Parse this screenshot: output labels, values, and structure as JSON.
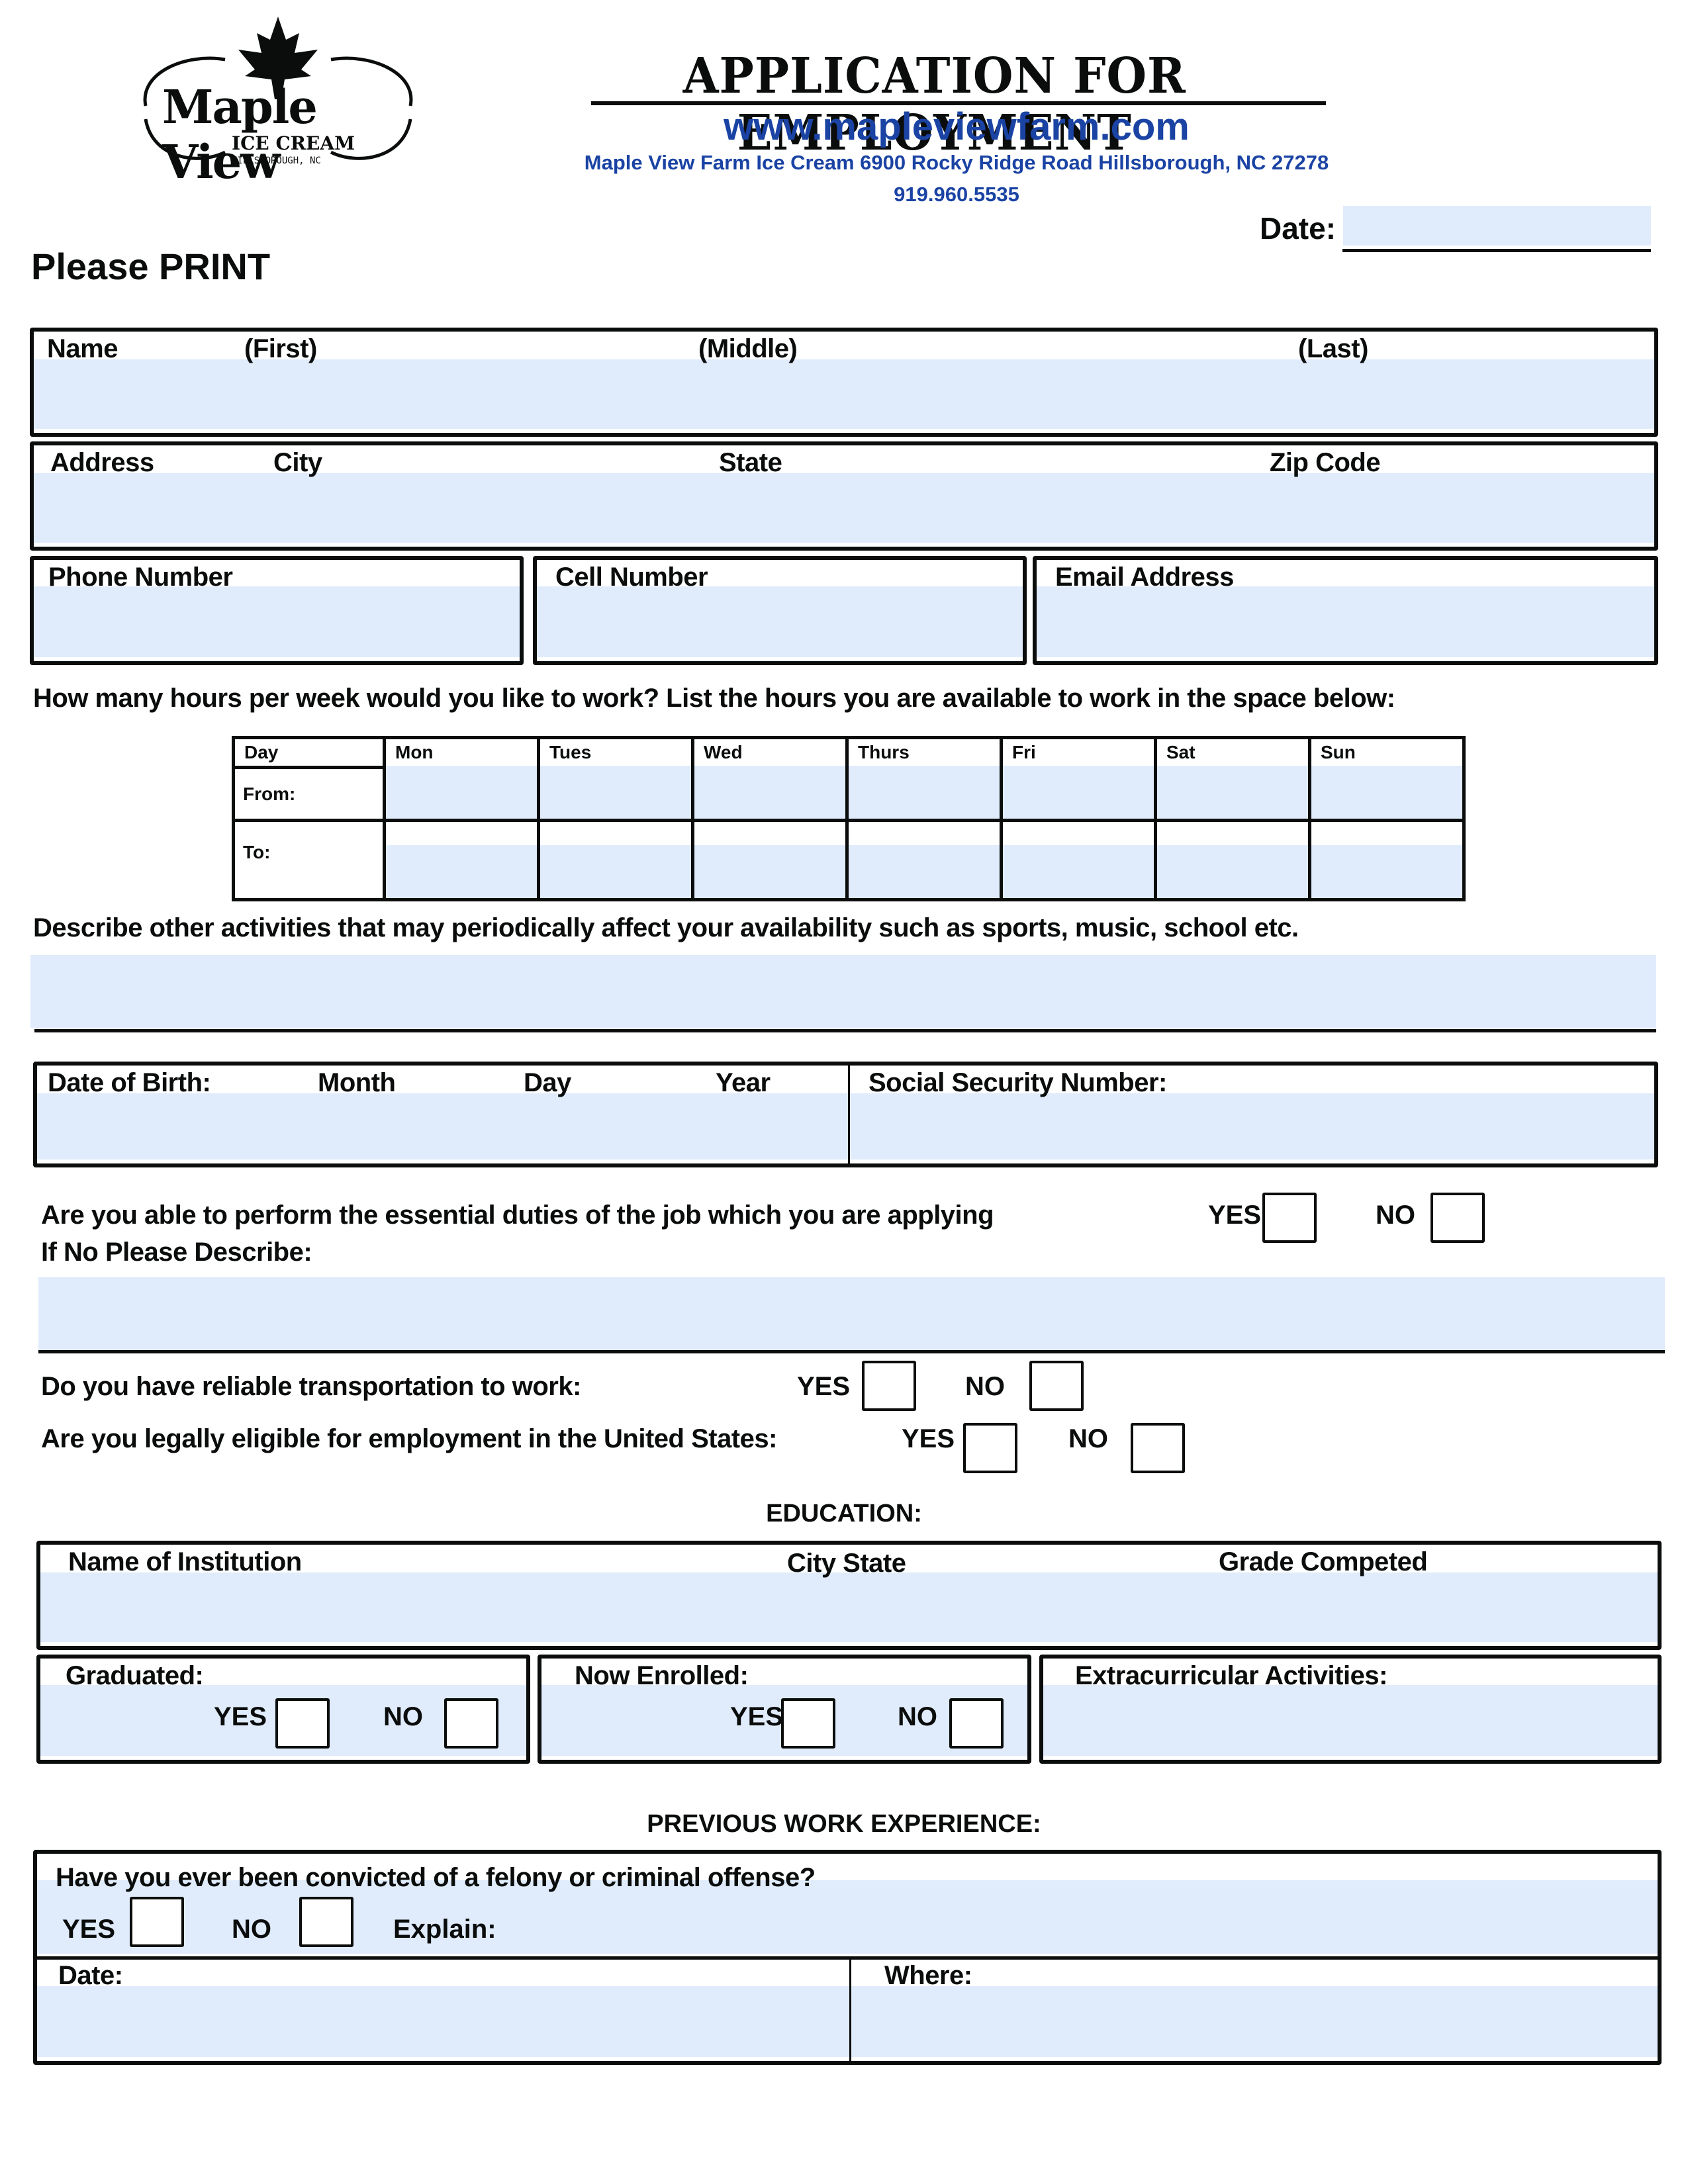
{
  "header": {
    "logo": {
      "name": "Maple View",
      "subtitle": "ICE CREAM",
      "location": "HILLSBOROUGH, NC"
    },
    "title": "APPLICATION FOR EMPLOYMENT",
    "website": "www.mapleviewfarm.com",
    "address": "Maple View Farm Ice Cream 6900 Rocky Ridge Road Hillsborough, NC 27278",
    "phone": "919.960.5535",
    "date_label": "Date:",
    "date_value": "",
    "instruction": "Please PRINT"
  },
  "personal": {
    "name_label": "Name",
    "name_first": "(First)",
    "name_middle": "(Middle)",
    "name_last": "(Last)",
    "name_value": "",
    "address_label": "Address",
    "city_label": "City",
    "state_label": "State",
    "zip_label": "Zip Code",
    "address_value": "",
    "phone_label": "Phone Number",
    "phone_value": "",
    "cell_label": "Cell Number",
    "cell_value": "",
    "email_label": "Email Address",
    "email_value": ""
  },
  "availability": {
    "question": "How many hours per week would you like to work? List the hours you are available to work in the space below:",
    "day_label": "Day",
    "from_label": "From:",
    "to_label": "To:",
    "days": [
      "Mon",
      "Tues",
      "Wed",
      "Thurs",
      "Fri",
      "Sat",
      "Sun"
    ],
    "from_values": [
      "",
      "",
      "",
      "",
      "",
      "",
      ""
    ],
    "to_values": [
      "",
      "",
      "",
      "",
      "",
      "",
      ""
    ],
    "other_activities_question": "Describe other activities that may periodically affect your availability such as sports, music, school etc.",
    "other_activities_value": ""
  },
  "identity": {
    "dob_label": "Date of Birth:",
    "month_label": "Month",
    "day_label": "Day",
    "year_label": "Year",
    "dob_value": "",
    "ssn_label": "Social Security Number:",
    "ssn_value": ""
  },
  "questions": {
    "essential_duties": "Are you able to perform the essential duties of the job which you are applying",
    "if_no_describe": "If No Please Describe:",
    "describe_value": "",
    "transportation": "Do you have reliable transportation to work:",
    "legally_eligible": "Are you legally eligible for employment in the United States:",
    "yes_label": "YES",
    "no_label": "NO"
  },
  "education": {
    "heading": "EDUCATION:",
    "institution_label": "Name of Institution",
    "city_state_label": "City State",
    "grade_label": "Grade Competed",
    "institution_value": "",
    "graduated_label": "Graduated:",
    "enrolled_label": "Now Enrolled:",
    "extracurricular_label": "Extracurricular Activities:",
    "extracurricular_value": ""
  },
  "work": {
    "heading": "PREVIOUS WORK EXPERIENCE:",
    "felony_question": "Have you ever been convicted of a felony or criminal offense?",
    "explain_label": "Explain:",
    "explain_value": "",
    "date_label": "Date:",
    "date_value": "",
    "where_label": "Where:",
    "where_value": ""
  },
  "colors": {
    "field_fill": "#e0ecfc",
    "brand_blue": "#1a43a4",
    "ink": "#0b0d0d"
  }
}
